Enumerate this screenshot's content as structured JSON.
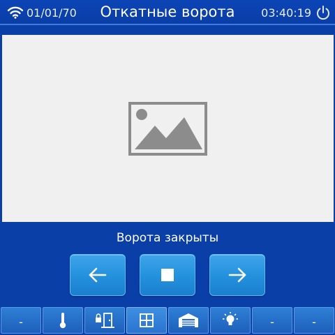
{
  "header": {
    "date": "01/01/70",
    "title": "Откатные ворота",
    "time": "03:40:19"
  },
  "status": {
    "text": "Ворота закрыты"
  },
  "controls": [
    {
      "icon": "arrow-left-icon"
    },
    {
      "icon": "stop-icon"
    },
    {
      "icon": "arrow-right-icon"
    }
  ],
  "tabs": [
    {
      "label": "-",
      "icon": null
    },
    {
      "label": "",
      "icon": "thermometer-icon"
    },
    {
      "label": "",
      "icon": "door-lock-icon"
    },
    {
      "label": "",
      "icon": "window-icon",
      "active": true
    },
    {
      "label": "",
      "icon": "garage-icon"
    },
    {
      "label": "",
      "icon": "light-bulb-icon"
    },
    {
      "label": "-",
      "icon": null
    },
    {
      "label": "-",
      "icon": null
    }
  ],
  "colors": {
    "background": "#0b3fa8",
    "button": "#2592de",
    "viewport": "#f0f0f0"
  }
}
